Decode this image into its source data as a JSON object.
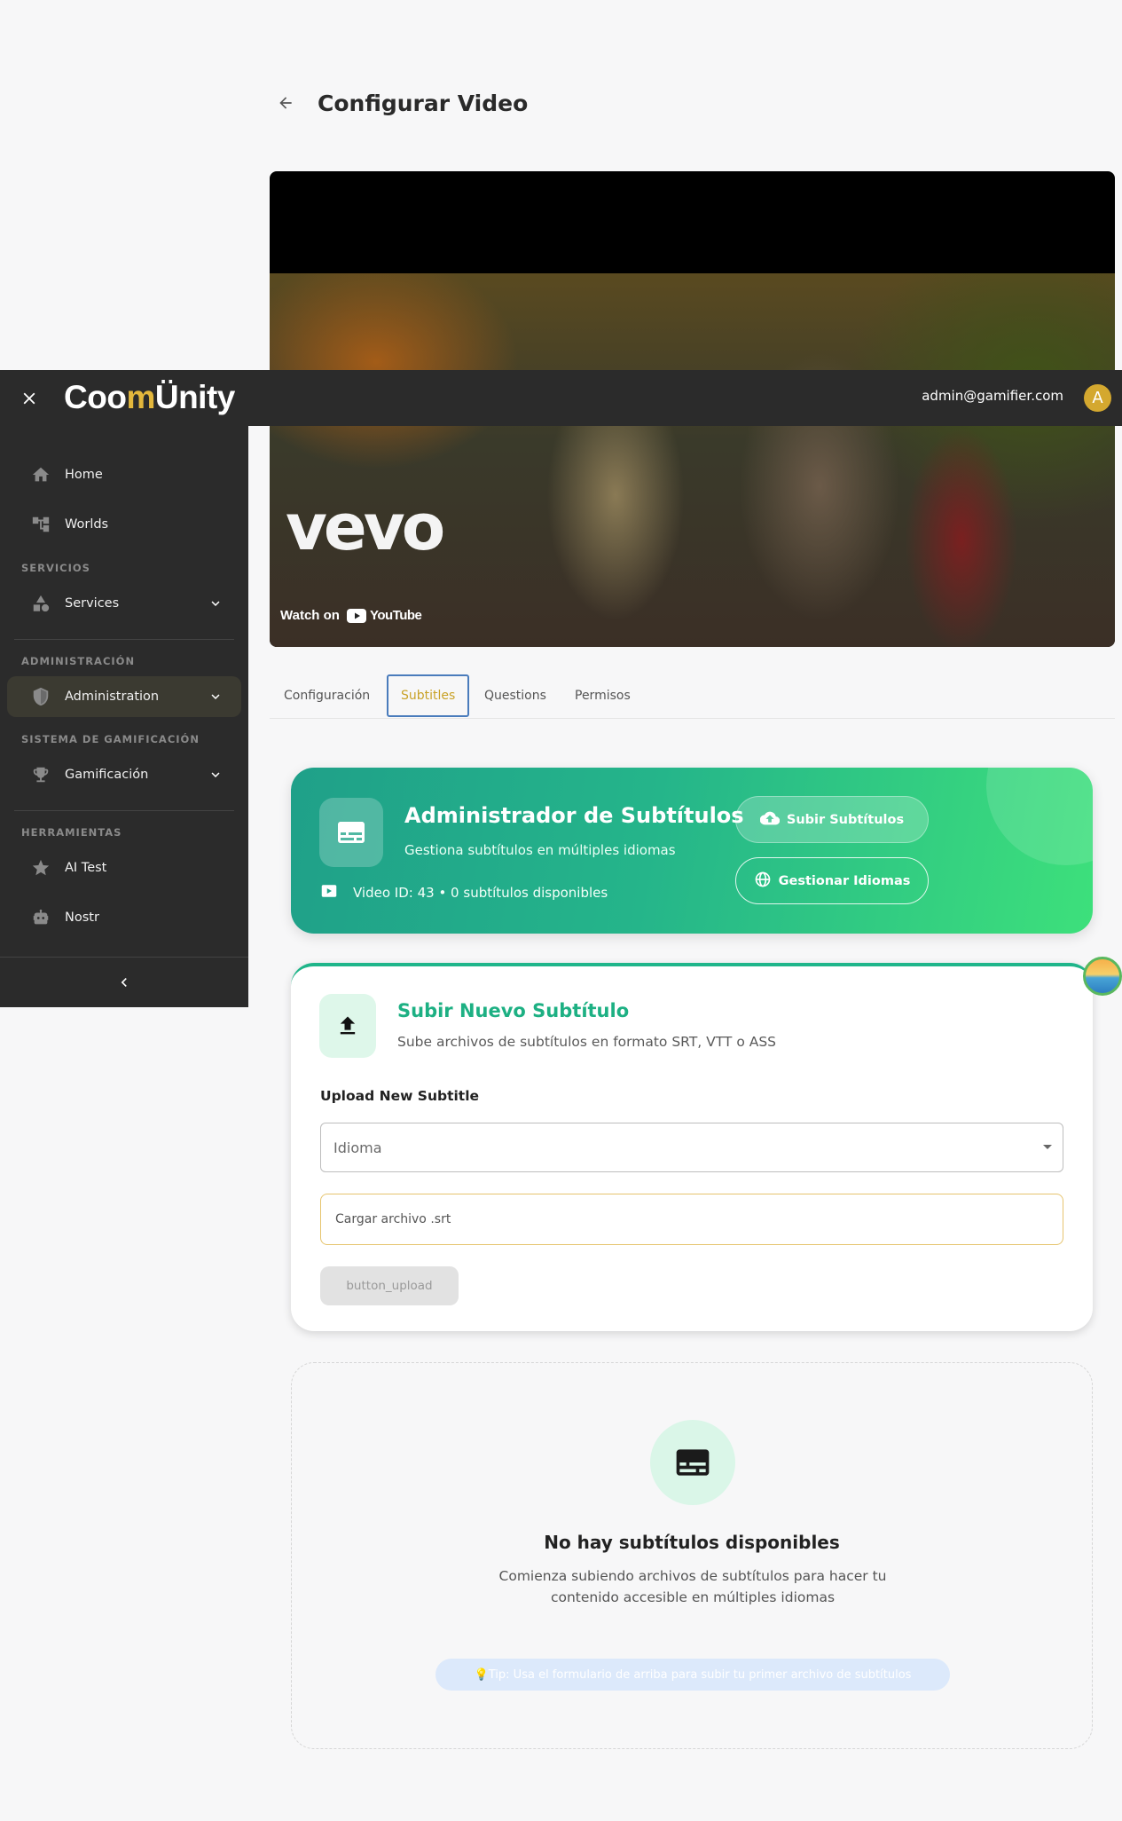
{
  "page": {
    "title": "Configurar Video"
  },
  "video": {
    "watermark": "vevo",
    "watch_on": "Watch on",
    "youtube": "YouTube"
  },
  "topbar": {
    "logo_part1": "Coo",
    "logo_part2": "m",
    "logo_part3": "Ünity",
    "user_email": "admin@gamifier.com",
    "avatar_initial": "A"
  },
  "sidebar": {
    "items": {
      "home": "Home",
      "worlds": "Worlds",
      "services": "Services",
      "administration": "Administration",
      "gamification": "Gamificación",
      "ai_test": "AI Test",
      "nostr": "Nostr"
    },
    "sections": {
      "services": "SERVICIOS",
      "administration": "ADMINISTRACIÓN",
      "gamification": "SISTEMA DE GAMIFICACIÓN",
      "tools": "HERRAMIENTAS"
    }
  },
  "tabs": [
    "Configuración",
    "Subtitles",
    "Questions",
    "Permisos"
  ],
  "hero": {
    "title": "Administrador de Subtítulos",
    "subtitle": "Gestiona subtítulos en múltiples idiomas",
    "meta": "Video ID: 43 • 0 subtítulos disponibles",
    "upload_button": "Subir Subtítulos",
    "languages_button": "Gestionar Idiomas"
  },
  "upload": {
    "title": "Subir Nuevo Subtítulo",
    "subtitle": "Sube archivos de subtítulos en formato SRT, VTT o ASS",
    "form_label": "Upload New Subtitle",
    "language_placeholder": "Idioma",
    "file_label": "Cargar archivo .srt",
    "button": "button_upload"
  },
  "empty": {
    "title": "No hay subtítulos disponibles",
    "subtitle": "Comienza subiendo archivos de subtítulos para hacer tu contenido accesible en múltiples idiomas",
    "tip": "💡Tip: Usa el formulario de arriba para subir tu primer archivo de subtítulos"
  },
  "colors": {
    "accent_gold": "#c9a227",
    "brand_green": "#1db083",
    "sidebar_bg": "#2b2b2b"
  }
}
